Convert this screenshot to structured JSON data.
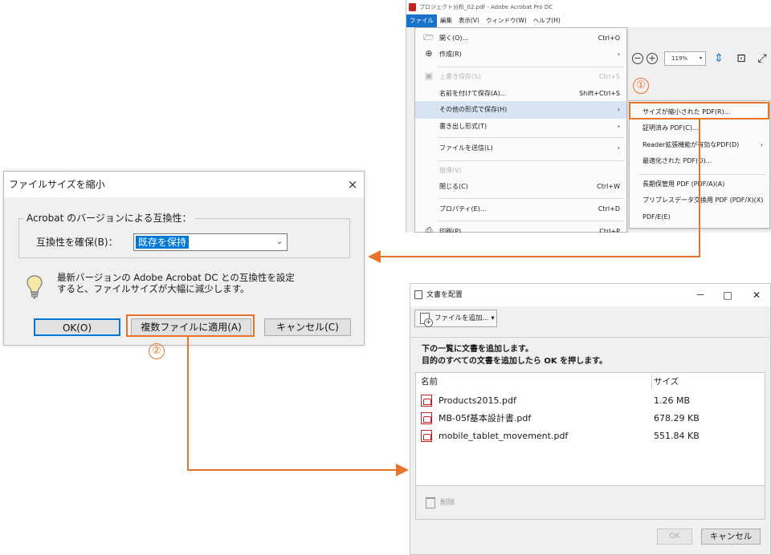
{
  "colors": {
    "accent_orange": "#e8742a",
    "selection_blue": "#0078d7",
    "menu_highlight": "#d8e4f4"
  },
  "acrobat": {
    "window_title": "プロジェクト分析_02.pdf - Adobe Acrobat Pro DC",
    "menubar": [
      "ファイル",
      "編集",
      "表示(V)",
      "ウィンドウ(W)",
      "ヘルプ(H)"
    ],
    "zoom": "119%",
    "file_menu": [
      {
        "label": "開く(O)...",
        "shortcut": "Ctrl+O",
        "icon": "folder-icon"
      },
      {
        "label": "作成(R)",
        "shortcut": "›",
        "icon": "create-icon"
      },
      {
        "label": "上書き保存(S)",
        "shortcut": "Ctrl+S",
        "icon": "save-icon"
      },
      {
        "label": "名前を付けて保存(A)...",
        "shortcut": "Shift+Ctrl+S"
      },
      {
        "label": "その他の形式で保存(H)",
        "shortcut": "›"
      },
      {
        "label": "書き出し形式(T)",
        "shortcut": "›"
      },
      {
        "label": "ファイルを送信(L)",
        "shortcut": "›"
      },
      {
        "label": "復帰(V)",
        "shortcut": ""
      },
      {
        "label": "閉じる(C)",
        "shortcut": "Ctrl+W"
      },
      {
        "label": "プロパティ(E)...",
        "shortcut": "Ctrl+D"
      },
      {
        "label": "印刷(P)...",
        "shortcut": "Ctrl+P",
        "icon": "print-icon"
      }
    ],
    "submenu": [
      {
        "label": "サイズが縮小された PDF(R)..."
      },
      {
        "label": "証明済み PDF(C)..."
      },
      {
        "label": "Reader拡張機能が有効なPDF(D)",
        "arrow": "›"
      },
      {
        "label": "最適化された PDF(O)..."
      },
      {
        "label": "長期保管用 PDF (PDF/A)(A)"
      },
      {
        "label": "プリプレスデータ交換用 PDF (PDF/X)(X)"
      },
      {
        "label": "PDF/E(E)"
      }
    ],
    "step_badge": "①"
  },
  "reduce_dialog": {
    "title": "ファイルサイズを縮小",
    "close": "×",
    "group_label": "Acrobat のバージョンによる互換性：",
    "compat_label": "互換性を確保(B)：",
    "compat_value": "既存を保持",
    "info_line1": "最新バージョンの Adobe Acrobat DC との互換性を設定",
    "info_line2": "すると、ファイルサイズが大幅に減少します。",
    "ok": "OK(O)",
    "apply_multiple": "複数ファイルに適用(A)",
    "cancel": "キャンセル(C)",
    "step_badge": "②"
  },
  "arrange": {
    "title": "文書を配置",
    "minimize": "－",
    "maximize": "□",
    "close": "✕",
    "add_files": "ファイルを追加...",
    "add_files_caret": "▾",
    "instruction_1": "下の一覧に文書を追加します。",
    "instruction_2": "目的のすべての文書を追加したら OK を押します。",
    "col_name": "名前",
    "col_size": "サイズ",
    "files": [
      {
        "name": "Products2015.pdf",
        "size": "1.26 MB"
      },
      {
        "name": "MB-05f基本設計書.pdf",
        "size": "678.29 KB"
      },
      {
        "name": "mobile_tablet_movement.pdf",
        "size": "551.84 KB"
      }
    ],
    "delete": "削除",
    "ok": "OK",
    "cancel": "キャンセル"
  }
}
